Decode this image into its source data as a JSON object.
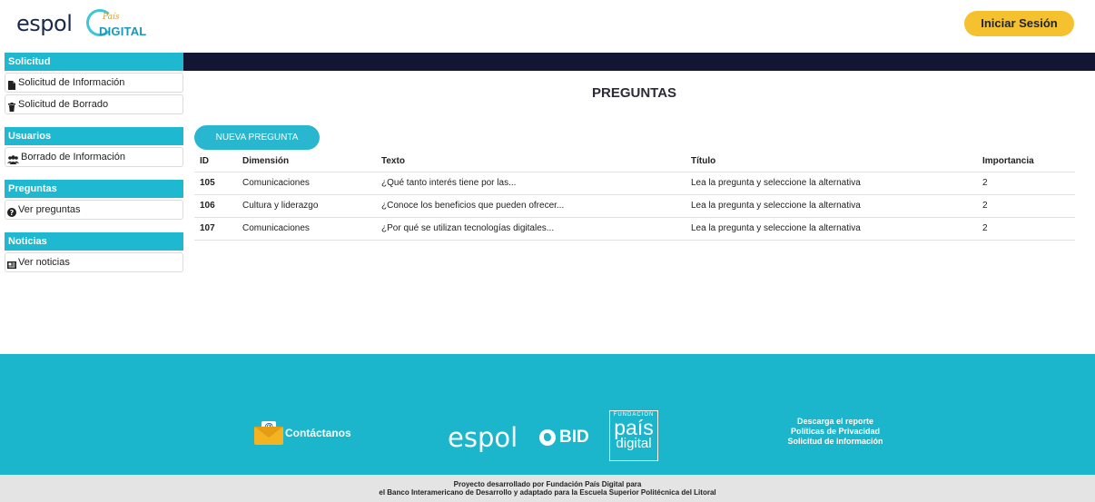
{
  "header": {
    "logo_espol": "espol",
    "logo_pais_small": "País",
    "logo_pais_big": "DIGITAL",
    "login_label": "Iniciar Sesión"
  },
  "sidebar": {
    "sections": [
      {
        "title": "Solicitud",
        "items": [
          {
            "label": "Solicitud de Información",
            "icon": "document-icon"
          },
          {
            "label": "Solicitud de Borrado",
            "icon": "trash-icon"
          }
        ]
      },
      {
        "title": "Usuarios",
        "items": [
          {
            "label": "Borrado de Información",
            "icon": "users-icon"
          }
        ]
      },
      {
        "title": "Preguntas",
        "items": [
          {
            "label": "Ver preguntas",
            "icon": "question-circle-icon"
          }
        ]
      },
      {
        "title": "Noticias",
        "items": [
          {
            "label": "Ver noticias",
            "icon": "newspaper-icon"
          }
        ]
      }
    ]
  },
  "main": {
    "title": "PREGUNTAS",
    "new_button": "NUEVA PREGUNTA",
    "table": {
      "headers": [
        "ID",
        "Dimensión",
        "Texto",
        "Título",
        "Importancia"
      ],
      "rows": [
        [
          "105",
          "Comunicaciones",
          "¿Qué tanto interés tiene por las...",
          "Lea la pregunta y seleccione la alternativa",
          "2"
        ],
        [
          "106",
          "Cultura y liderazgo",
          "¿Conoce los beneficios que pueden ofrecer...",
          "Lea la pregunta y seleccione la alternativa",
          "2"
        ],
        [
          "107",
          "Comunicaciones",
          "¿Por qué se utilizan tecnologías digitales...",
          "Lea la pregunta y seleccione la alternativa",
          "2"
        ]
      ]
    }
  },
  "footer": {
    "contact_label": "Contáctanos",
    "logo_espol": "espol",
    "logo_bid": "BID",
    "logo_pais_fund": "FUNDACIÓN",
    "logo_pais_1": "país",
    "logo_pais_2": "digital",
    "links": [
      "Descarga el reporte",
      "Políticas de Privacidad",
      "Solicitud de información"
    ],
    "credit_line1": "Proyecto desarrollado por Fundación País Digital para",
    "credit_line2": "el Banco Interamericano de Desarrollo y adaptado para la Escuela Superior Politécnica del Litoral"
  },
  "colors": {
    "accent": "#1fb8d1",
    "login": "#f5c12e",
    "banner": "#141433",
    "footer": "#1cb6cc"
  }
}
